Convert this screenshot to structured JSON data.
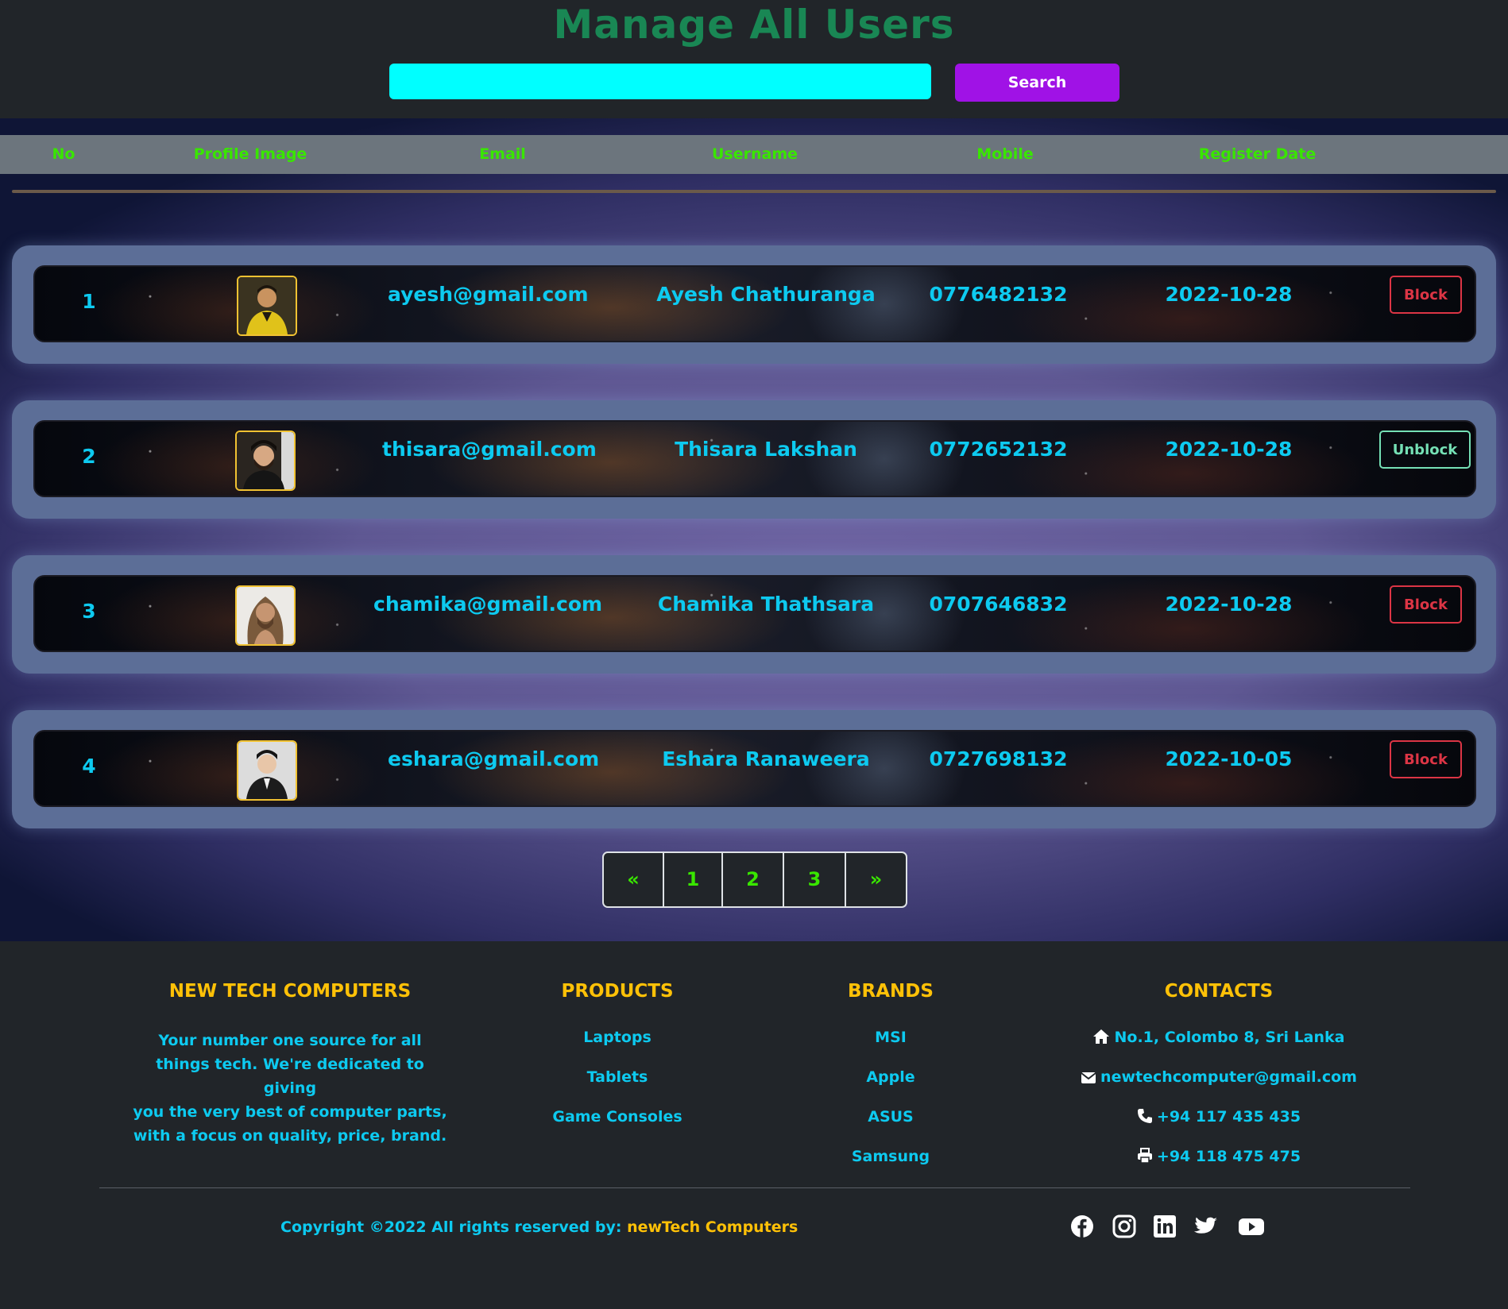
{
  "header": {
    "title": "Manage All Users",
    "search": {
      "value": "",
      "placeholder": "",
      "button_label": "Search"
    },
    "colors": {
      "title": "#198754",
      "search_input": "#00ffff",
      "search_button": "#a012e6"
    }
  },
  "table": {
    "columns": [
      "No",
      "Profile Image",
      "Email",
      "Username",
      "Mobile",
      "Register Date"
    ],
    "rows": [
      {
        "no": "1",
        "email": "ayesh@gmail.com",
        "username": "Ayesh Chathuranga",
        "mobile": "0776482132",
        "date": "2022-10-28",
        "action": "Block",
        "avatar": "avatar-yellow-shirt"
      },
      {
        "no": "2",
        "email": "thisara@gmail.com",
        "username": "Thisara Lakshan",
        "mobile": "0772652132",
        "date": "2022-10-28",
        "action": "Unblock",
        "avatar": "avatar-dark-hair-beard"
      },
      {
        "no": "3",
        "email": "chamika@gmail.com",
        "username": "Chamika Thathsara",
        "mobile": "0707646832",
        "date": "2022-10-28",
        "action": "Block",
        "avatar": "avatar-long-hair"
      },
      {
        "no": "4",
        "email": "eshara@gmail.com",
        "username": "Eshara Ranaweera",
        "mobile": "0727698132",
        "date": "2022-10-05",
        "action": "Block",
        "avatar": "avatar-dark-suit"
      }
    ]
  },
  "pagination": {
    "prev": "«",
    "pages": [
      "1",
      "2",
      "3"
    ],
    "next": "»"
  },
  "footer": {
    "about": {
      "heading": "NEW TECH COMPUTERS",
      "lines": [
        "Your number one source for all",
        "things tech. We're dedicated to giving",
        "you the very best of computer parts,",
        "with a focus on quality, price, brand."
      ]
    },
    "products": {
      "heading": "PRODUCTS",
      "items": [
        "Laptops",
        "Tablets",
        "Game Consoles"
      ]
    },
    "brands": {
      "heading": "BRANDS",
      "items": [
        "MSI",
        "Apple",
        "ASUS",
        "Samsung"
      ]
    },
    "contacts": {
      "heading": "CONTACTS",
      "address": "No.1, Colombo 8, Sri Lanka",
      "email": "newtechcomputer@gmail.com",
      "phone": "+94 117 435 435",
      "fax": "+94 118 475 475"
    },
    "copyright_prefix": "Copyright ©2022 All rights reserved by:",
    "copyright_brand": "newTech Computers",
    "social": [
      "facebook-icon",
      "instagram-icon",
      "linkedin-icon",
      "twitter-icon",
      "youtube-icon"
    ]
  }
}
